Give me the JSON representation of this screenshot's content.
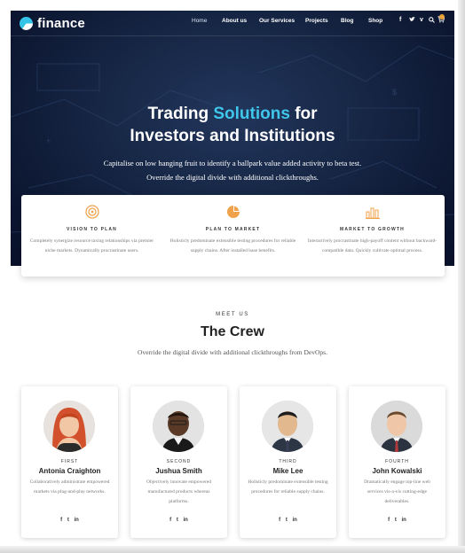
{
  "nav": {
    "logo_text": "finance",
    "items": [
      "Home",
      "About us",
      "Our Services",
      "Projects",
      "Blog",
      "Shop"
    ],
    "social": {
      "facebook": "f",
      "twitter": "t",
      "vine": "v"
    },
    "search_icon": "search-icon",
    "cart_icon": "cart-icon"
  },
  "hero": {
    "title_part1": "Trading ",
    "title_accent": "Solutions",
    "title_part2": " for",
    "title_line2": "Investors and Institutions",
    "subtitle_line1": "Capitalise on low hanging fruit to identify a ballpark value added activity to beta test.",
    "subtitle_line2": "Override the digital divide with additional clickthroughs.",
    "accent_color": "#3fc6ea"
  },
  "features": [
    {
      "icon": "target-icon",
      "title": "VISION TO PLAN",
      "text": "Completely synergize resource taxing relationships via premier niche markets. Dynamically procrastinate users."
    },
    {
      "icon": "pie-chart-icon",
      "title": "PLAN TO MARKET",
      "text": "Holisticly predominate extensible testing procedures for reliable supply chains. After installed base benefits."
    },
    {
      "icon": "bar-chart-icon",
      "title": "MARKET TO GROWTH",
      "text": "Interactively procrastinate high-payoff content without backward-compatible data. Quickly cultivate optimal process."
    }
  ],
  "crew": {
    "eyebrow": "MEET US",
    "title": "The Crew",
    "subtitle": "Override the digital divide with additional clickthroughs from DevOps.",
    "members": [
      {
        "rank": "FIRST",
        "name": "Antonia Craighton",
        "desc": "Collaboratively administrate empowered markets via plug-and-play networks."
      },
      {
        "rank": "SECOND",
        "name": "Jushua Smith",
        "desc": "Objectively innovate empowered manufactured products whereas platforms."
      },
      {
        "rank": "THIRD",
        "name": "Mike Lee",
        "desc": "Holisticly predominate extensible testing procedures for reliable supply chains."
      },
      {
        "rank": "FOURTH",
        "name": "John Kowalski",
        "desc": "Dramatically engage top-line web services vis-a-vis cutting-edge deliverables."
      }
    ],
    "social": {
      "facebook": "f",
      "twitter": "t",
      "linkedin": "in"
    }
  },
  "colors": {
    "hero_dark": "#0c1630",
    "icon_orange": "#f0a24a",
    "cart_badge": "#e9a13b"
  }
}
